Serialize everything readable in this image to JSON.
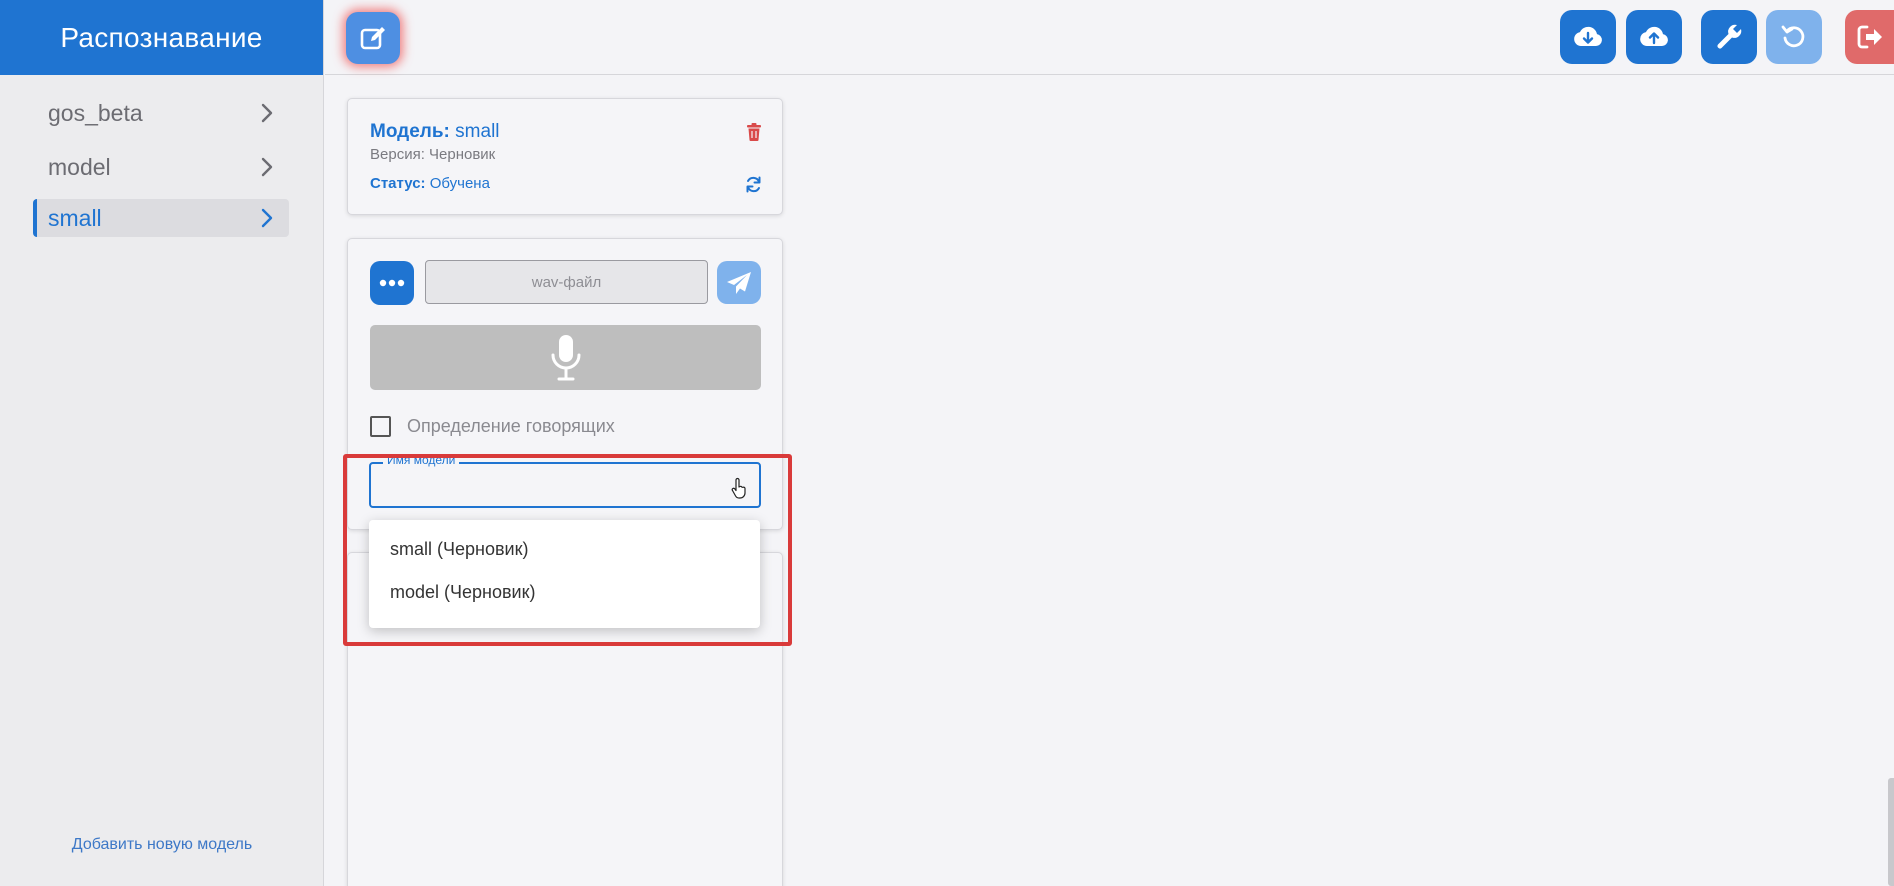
{
  "sidebar": {
    "brand": "Распознавание",
    "items": [
      {
        "label": "gos_beta"
      },
      {
        "label": "model"
      },
      {
        "label": "small"
      }
    ],
    "add_model": "Добавить новую модель"
  },
  "toolbar": {
    "icons": [
      "edit-icon",
      "cloud-download-icon",
      "cloud-upload-icon",
      "wrench-icon",
      "undo-icon",
      "logout-icon"
    ],
    "colors": {
      "primary": "#1f74d1",
      "light": "#7fb2ec",
      "danger": "#e06a6a"
    }
  },
  "model_card": {
    "title_label": "Модель:",
    "title_value": "small",
    "version": "Версия: Черновик",
    "status_label": "Статус:",
    "status_value": "Обучена"
  },
  "recognition": {
    "file_placeholder": "wav-файл",
    "speakers_label": "Определение говорящих",
    "model_select_label": "Имя модели",
    "options": [
      "small (Черновик)",
      "model (Черновик)"
    ]
  }
}
